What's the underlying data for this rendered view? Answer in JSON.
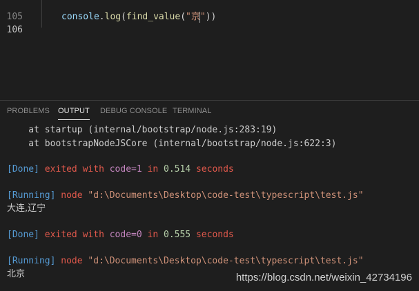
{
  "editor": {
    "lines": [
      {
        "number": "105",
        "text": ""
      },
      {
        "number": "106",
        "tokens": {
          "obj": "console",
          "dot": ".",
          "fn1": "log",
          "p1": "(",
          "fn2": "find_value",
          "p2": "(",
          "str_open": "\"京",
          "str_close": "\"",
          "p3": "))"
        }
      }
    ]
  },
  "panel": {
    "tabs": [
      {
        "label": "PROBLEMS",
        "active": false
      },
      {
        "label": "OUTPUT",
        "active": true
      },
      {
        "label": "DEBUG CONSOLE",
        "active": false
      },
      {
        "label": "TERMINAL",
        "active": false
      }
    ]
  },
  "output": {
    "stack1": "    at startup (internal/bootstrap/node.js:283:19)",
    "stack2": "    at bootstrapNodeJSCore (internal/bootstrap/node.js:622:3)",
    "done1": {
      "tag": "[Done]",
      "exited": "exited with",
      "code": "code=1",
      "in": "in",
      "time": "0.514",
      "seconds": "seconds"
    },
    "run1": {
      "tag": "[Running]",
      "cmd": "node",
      "path": "\"d:\\Documents\\Desktop\\code-test\\typescript\\test.js\""
    },
    "result1": "大连,辽宁",
    "done2": {
      "tag": "[Done]",
      "exited": "exited with",
      "code": "code=0",
      "in": "in",
      "time": "0.555",
      "seconds": "seconds"
    },
    "run2": {
      "tag": "[Running]",
      "cmd": "node",
      "path": "\"d:\\Documents\\Desktop\\code-test\\typescript\\test.js\""
    },
    "result2": "北京"
  },
  "watermark": "https://blog.csdn.net/weixin_42734196"
}
